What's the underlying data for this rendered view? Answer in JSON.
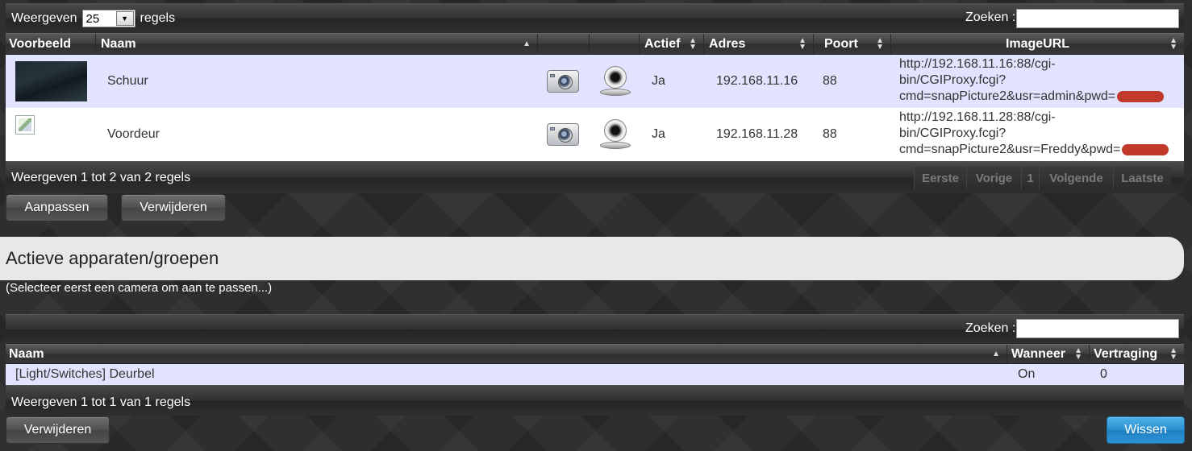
{
  "cameras_table": {
    "length": {
      "prefix": "Weergeven",
      "value": "25",
      "suffix": "regels"
    },
    "search_label": "Zoeken :",
    "columns": {
      "preview": "Voorbeeld",
      "name": "Naam",
      "active": "Actief",
      "address": "Adres",
      "port": "Poort",
      "imageurl": "ImageURL"
    },
    "rows": [
      {
        "name": "Schuur",
        "active": "Ja",
        "address": "192.168.11.16",
        "port": "88",
        "url_line1": "http://192.168.11.16:88/cgi-",
        "url_line2": "bin/CGIProxy.fcgi?",
        "url_line3": "cmd=snapPicture2&usr=admin&pwd="
      },
      {
        "name": "Voordeur",
        "active": "Ja",
        "address": "192.168.11.28",
        "port": "88",
        "url_line1": "http://192.168.11.28:88/cgi-",
        "url_line2": "bin/CGIProxy.fcgi?",
        "url_line3": "cmd=snapPicture2&usr=Freddy&pwd="
      }
    ],
    "info": "Weergeven 1 tot 2 van 2 regels",
    "pager": {
      "first": "Eerste",
      "prev": "Vorige",
      "page": "1",
      "next": "Volgende",
      "last": "Laatste"
    }
  },
  "buttons": {
    "edit": "Aanpassen",
    "delete": "Verwijderen"
  },
  "section": {
    "title": "Actieve apparaten/groepen",
    "hint": "(Selecteer eerst een camera om aan te passen...)"
  },
  "devices_table": {
    "search_label": "Zoeken :",
    "columns": {
      "name": "Naam",
      "when": "Wanneer",
      "delay": "Vertraging"
    },
    "rows": [
      {
        "name": "[Light/Switches] Deurbel",
        "when": "On",
        "delay": "0"
      }
    ],
    "info": "Weergeven 1 tot 1 van 1 regels"
  },
  "bottom_buttons": {
    "delete": "Verwijderen",
    "clear": "Wissen"
  }
}
